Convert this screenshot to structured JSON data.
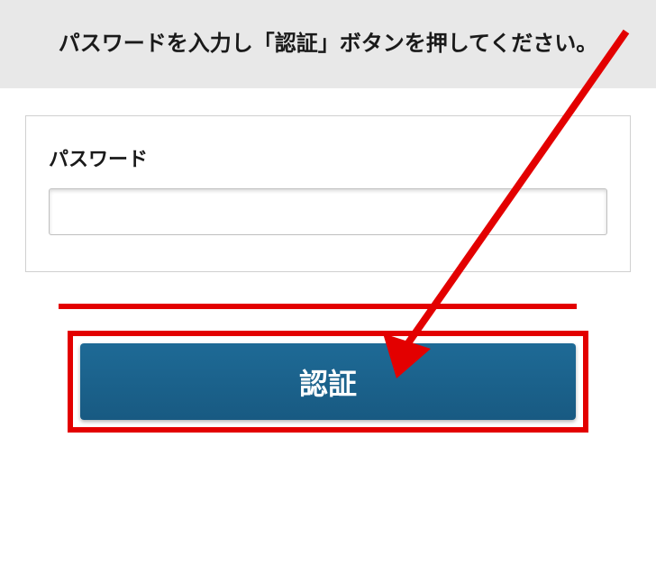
{
  "header": {
    "instruction": "パスワードを入力し「認証」ボタンを押してください。"
  },
  "form": {
    "password_label": "パスワード",
    "password_value": "",
    "password_placeholder": ""
  },
  "actions": {
    "auth_button_label": "認証"
  },
  "annotations": {
    "highlight_color": "#e30000",
    "arrow_color": "#e30000"
  }
}
